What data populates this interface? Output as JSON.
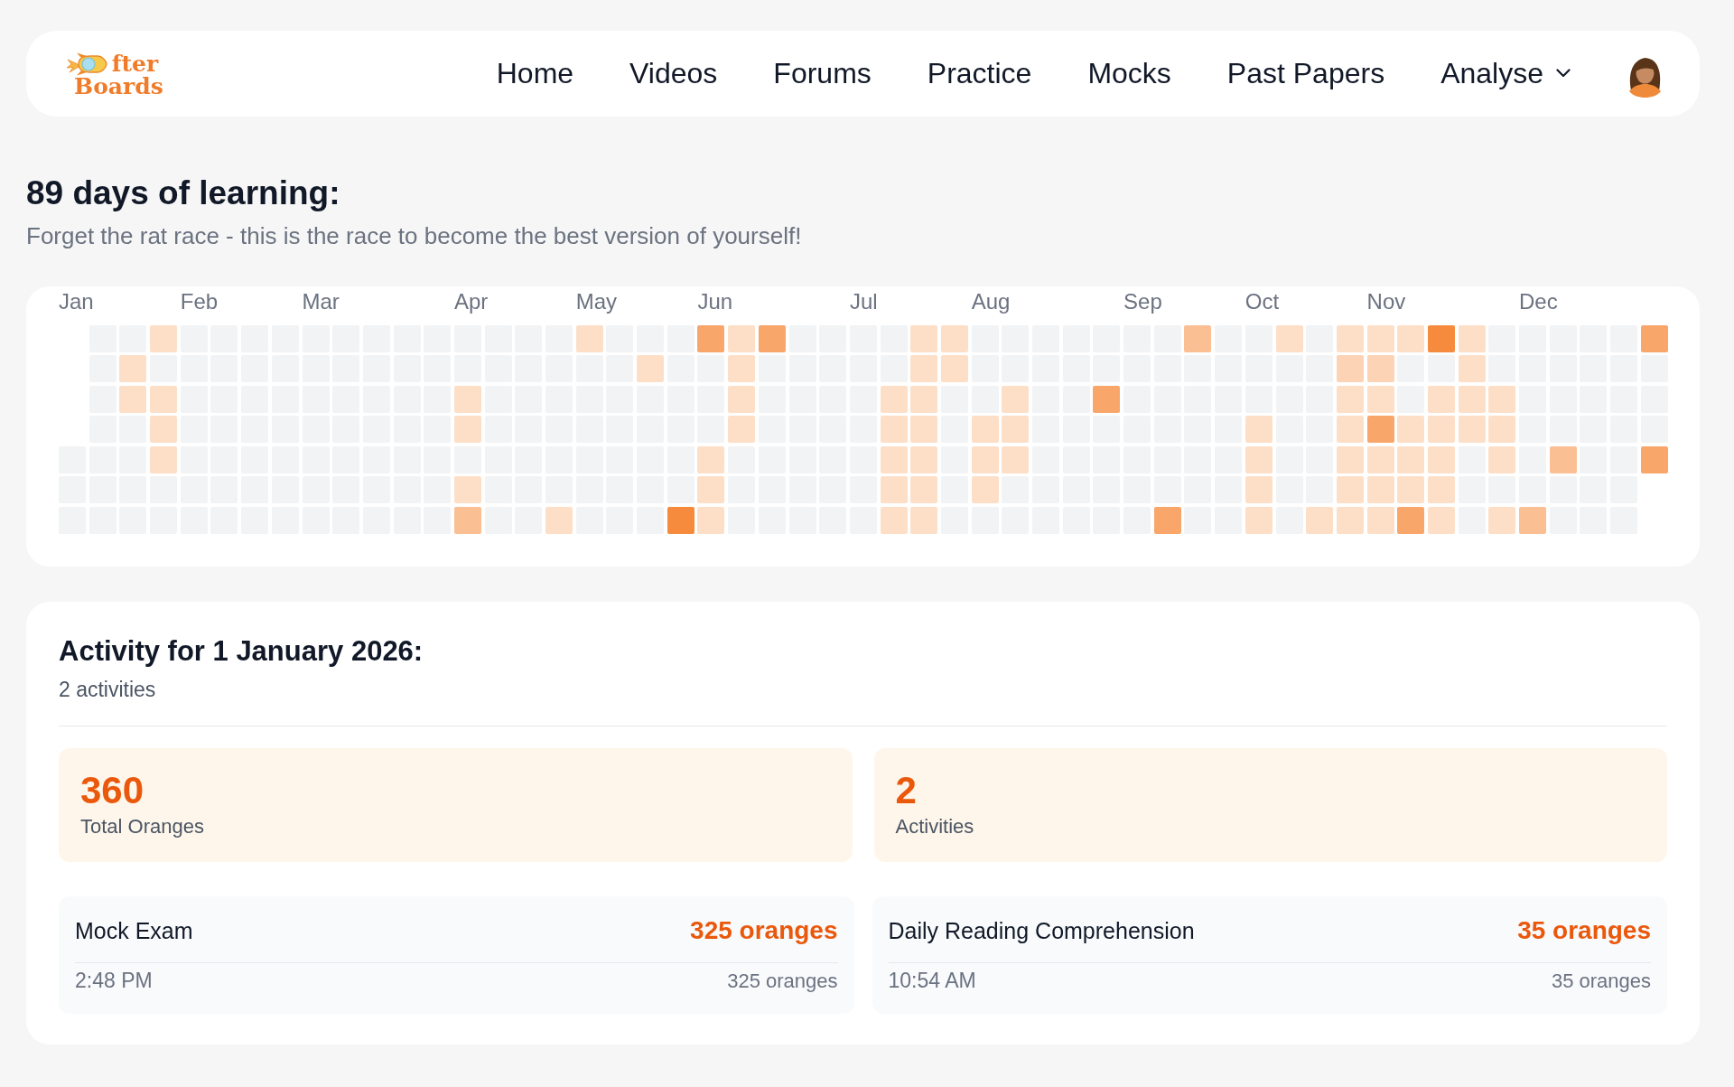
{
  "navbar": {
    "logo": {
      "lines": [
        "fter",
        "Boards"
      ]
    },
    "links": [
      {
        "label": "Home",
        "kind": "link"
      },
      {
        "label": "Videos",
        "kind": "link"
      },
      {
        "label": "Forums",
        "kind": "link"
      },
      {
        "label": "Practice",
        "kind": "link"
      },
      {
        "label": "Mocks",
        "kind": "link"
      },
      {
        "label": "Past Papers",
        "kind": "link"
      },
      {
        "label": "Analyse",
        "kind": "dropdown"
      }
    ]
  },
  "heading": {
    "title": "89 days of learning:",
    "subtitle": "Forget the rat race - this is the race to become the best version of yourself!"
  },
  "heatmap": {
    "weeks": [
      {
        "month": "Jan",
        "days": [
          {
            "color": "#f1f3f5"
          },
          {
            "color": "#f1f3f5"
          },
          {
            "color": "#f1f3f5"
          }
        ]
      },
      {
        "days": [
          {
            "color": "#f1f3f5"
          },
          {
            "color": "#f1f3f5"
          },
          {
            "color": "#f1f3f5"
          },
          {
            "color": "#f1f3f5"
          },
          {
            "color": "#f1f3f5"
          },
          {
            "color": "#f1f3f5"
          },
          {
            "color": "#f1f3f5"
          }
        ]
      },
      {
        "days": [
          {
            "color": "#f1f3f5"
          },
          {
            "color": "#fddfc8"
          },
          {
            "color": "#fddfc8"
          },
          {
            "color": "#f1f3f5"
          },
          {
            "color": "#f1f3f5"
          },
          {
            "color": "#f1f3f5"
          },
          {
            "color": "#f1f3f5"
          }
        ]
      },
      {
        "days": [
          {
            "color": "#fddfc8"
          },
          {
            "color": "#f1f3f5"
          },
          {
            "color": "#fddfc8"
          },
          {
            "color": "#fddfc8"
          },
          {
            "color": "#fddfc8"
          },
          {
            "color": "#f1f3f5"
          },
          {
            "color": "#f1f3f5"
          }
        ]
      },
      {
        "month": "Feb",
        "days": [
          {
            "color": "#f1f3f5"
          },
          {
            "color": "#f1f3f5"
          },
          {
            "color": "#f1f3f5"
          },
          {
            "color": "#f1f3f5"
          },
          {
            "color": "#f1f3f5"
          },
          {
            "color": "#f1f3f5"
          },
          {
            "color": "#f1f3f5"
          }
        ]
      },
      {
        "days": [
          {
            "color": "#f1f3f5"
          },
          {
            "color": "#f1f3f5"
          },
          {
            "color": "#f1f3f5"
          },
          {
            "color": "#f1f3f5"
          },
          {
            "color": "#f1f3f5"
          },
          {
            "color": "#f1f3f5"
          },
          {
            "color": "#f1f3f5"
          }
        ]
      },
      {
        "days": [
          {
            "color": "#f1f3f5"
          },
          {
            "color": "#f1f3f5"
          },
          {
            "color": "#f1f3f5"
          },
          {
            "color": "#f1f3f5"
          },
          {
            "color": "#f1f3f5"
          },
          {
            "color": "#f1f3f5"
          },
          {
            "color": "#f1f3f5"
          }
        ]
      },
      {
        "days": [
          {
            "color": "#f1f3f5"
          },
          {
            "color": "#f1f3f5"
          },
          {
            "color": "#f1f3f5"
          },
          {
            "color": "#f1f3f5"
          },
          {
            "color": "#f1f3f5"
          },
          {
            "color": "#f1f3f5"
          },
          {
            "color": "#f1f3f5"
          }
        ]
      },
      {
        "month": "Mar",
        "days": [
          {
            "color": "#f1f3f5"
          },
          {
            "color": "#f1f3f5"
          },
          {
            "color": "#f1f3f5"
          },
          {
            "color": "#f1f3f5"
          },
          {
            "color": "#f1f3f5"
          },
          {
            "color": "#f1f3f5"
          },
          {
            "color": "#f1f3f5"
          }
        ]
      },
      {
        "days": [
          {
            "color": "#f1f3f5"
          },
          {
            "color": "#f1f3f5"
          },
          {
            "color": "#f1f3f5"
          },
          {
            "color": "#f1f3f5"
          },
          {
            "color": "#f1f3f5"
          },
          {
            "color": "#f1f3f5"
          },
          {
            "color": "#f1f3f5"
          }
        ]
      },
      {
        "days": [
          {
            "color": "#f1f3f5"
          },
          {
            "color": "#f1f3f5"
          },
          {
            "color": "#f1f3f5"
          },
          {
            "color": "#f1f3f5"
          },
          {
            "color": "#f1f3f5"
          },
          {
            "color": "#f1f3f5"
          },
          {
            "color": "#f1f3f5"
          }
        ]
      },
      {
        "days": [
          {
            "color": "#f1f3f5"
          },
          {
            "color": "#f1f3f5"
          },
          {
            "color": "#f1f3f5"
          },
          {
            "color": "#f1f3f5"
          },
          {
            "color": "#f1f3f5"
          },
          {
            "color": "#f1f3f5"
          },
          {
            "color": "#f1f3f5"
          }
        ]
      },
      {
        "days": [
          {
            "color": "#f1f3f5"
          },
          {
            "color": "#f1f3f5"
          },
          {
            "color": "#f1f3f5"
          },
          {
            "color": "#f1f3f5"
          },
          {
            "color": "#f1f3f5"
          },
          {
            "color": "#f1f3f5"
          },
          {
            "color": "#f1f3f5"
          }
        ]
      },
      {
        "month": "Apr",
        "days": [
          {
            "color": "#f1f3f5"
          },
          {
            "color": "#f1f3f5"
          },
          {
            "color": "#fddfc8"
          },
          {
            "color": "#fddfc8"
          },
          {
            "color": "#f1f3f5"
          },
          {
            "color": "#fddfc8"
          },
          {
            "color": "#fbbf94"
          }
        ]
      },
      {
        "days": [
          {
            "color": "#f1f3f5"
          },
          {
            "color": "#f1f3f5"
          },
          {
            "color": "#f1f3f5"
          },
          {
            "color": "#f1f3f5"
          },
          {
            "color": "#f1f3f5"
          },
          {
            "color": "#f1f3f5"
          },
          {
            "color": "#f1f3f5"
          }
        ]
      },
      {
        "days": [
          {
            "color": "#f1f3f5"
          },
          {
            "color": "#f1f3f5"
          },
          {
            "color": "#f1f3f5"
          },
          {
            "color": "#f1f3f5"
          },
          {
            "color": "#f1f3f5"
          },
          {
            "color": "#f1f3f5"
          },
          {
            "color": "#f1f3f5"
          }
        ]
      },
      {
        "days": [
          {
            "color": "#f1f3f5"
          },
          {
            "color": "#f1f3f5"
          },
          {
            "color": "#f1f3f5"
          },
          {
            "color": "#f1f3f5"
          },
          {
            "color": "#f1f3f5"
          },
          {
            "color": "#f1f3f5"
          },
          {
            "color": "#fddfc8"
          }
        ]
      },
      {
        "month": "May",
        "days": [
          {
            "color": "#fddfc8"
          },
          {
            "color": "#f1f3f5"
          },
          {
            "color": "#f1f3f5"
          },
          {
            "color": "#f1f3f5"
          },
          {
            "color": "#f1f3f5"
          },
          {
            "color": "#f1f3f5"
          },
          {
            "color": "#f1f3f5"
          }
        ]
      },
      {
        "days": [
          {
            "color": "#f1f3f5"
          },
          {
            "color": "#f1f3f5"
          },
          {
            "color": "#f1f3f5"
          },
          {
            "color": "#f1f3f5"
          },
          {
            "color": "#f1f3f5"
          },
          {
            "color": "#f1f3f5"
          },
          {
            "color": "#f1f3f5"
          }
        ]
      },
      {
        "days": [
          {
            "color": "#f1f3f5"
          },
          {
            "color": "#fddfc8"
          },
          {
            "color": "#f1f3f5"
          },
          {
            "color": "#f1f3f5"
          },
          {
            "color": "#f1f3f5"
          },
          {
            "color": "#f1f3f5"
          },
          {
            "color": "#f1f3f5"
          }
        ]
      },
      {
        "days": [
          {
            "color": "#f1f3f5"
          },
          {
            "color": "#f1f3f5"
          },
          {
            "color": "#f1f3f5"
          },
          {
            "color": "#f1f3f5"
          },
          {
            "color": "#f1f3f5"
          },
          {
            "color": "#f1f3f5"
          },
          {
            "color": "#f78b3d"
          }
        ]
      },
      {
        "month": "Jun",
        "days": [
          {
            "color": "#f9a66b"
          },
          {
            "color": "#f1f3f5"
          },
          {
            "color": "#f1f3f5"
          },
          {
            "color": "#f1f3f5"
          },
          {
            "color": "#fddfc8"
          },
          {
            "color": "#fddfc8"
          },
          {
            "color": "#fddfc8"
          }
        ]
      },
      {
        "days": [
          {
            "color": "#fddfc8"
          },
          {
            "color": "#fddfc8"
          },
          {
            "color": "#fddfc8"
          },
          {
            "color": "#fddfc8"
          },
          {
            "color": "#f1f3f5"
          },
          {
            "color": "#f1f3f5"
          },
          {
            "color": "#f1f3f5"
          }
        ]
      },
      {
        "days": [
          {
            "color": "#f9a66b"
          },
          {
            "color": "#f1f3f5"
          },
          {
            "color": "#f1f3f5"
          },
          {
            "color": "#f1f3f5"
          },
          {
            "color": "#f1f3f5"
          },
          {
            "color": "#f1f3f5"
          },
          {
            "color": "#f1f3f5"
          }
        ]
      },
      {
        "days": [
          {
            "color": "#f1f3f5"
          },
          {
            "color": "#f1f3f5"
          },
          {
            "color": "#f1f3f5"
          },
          {
            "color": "#f1f3f5"
          },
          {
            "color": "#f1f3f5"
          },
          {
            "color": "#f1f3f5"
          },
          {
            "color": "#f1f3f5"
          }
        ]
      },
      {
        "days": [
          {
            "color": "#f1f3f5"
          },
          {
            "color": "#f1f3f5"
          },
          {
            "color": "#f1f3f5"
          },
          {
            "color": "#f1f3f5"
          },
          {
            "color": "#f1f3f5"
          },
          {
            "color": "#f1f3f5"
          },
          {
            "color": "#f1f3f5"
          }
        ]
      },
      {
        "month": "Jul",
        "days": [
          {
            "color": "#f1f3f5"
          },
          {
            "color": "#f1f3f5"
          },
          {
            "color": "#f1f3f5"
          },
          {
            "color": "#f1f3f5"
          },
          {
            "color": "#f1f3f5"
          },
          {
            "color": "#f1f3f5"
          },
          {
            "color": "#f1f3f5"
          }
        ]
      },
      {
        "days": [
          {
            "color": "#f1f3f5"
          },
          {
            "color": "#f1f3f5"
          },
          {
            "color": "#fddfc8"
          },
          {
            "color": "#fddfc8"
          },
          {
            "color": "#fddfc8"
          },
          {
            "color": "#fddfc8"
          },
          {
            "color": "#fddfc8"
          }
        ]
      },
      {
        "days": [
          {
            "color": "#fddfc8"
          },
          {
            "color": "#fddfc8"
          },
          {
            "color": "#fddfc8"
          },
          {
            "color": "#fddfc8"
          },
          {
            "color": "#fddfc8"
          },
          {
            "color": "#fddfc8"
          },
          {
            "color": "#fddfc8"
          }
        ]
      },
      {
        "days": [
          {
            "color": "#fddfc8"
          },
          {
            "color": "#fddfc8"
          },
          {
            "color": "#f1f3f5"
          },
          {
            "color": "#f1f3f5"
          },
          {
            "color": "#f1f3f5"
          },
          {
            "color": "#f1f3f5"
          },
          {
            "color": "#f1f3f5"
          }
        ]
      },
      {
        "month": "Aug",
        "days": [
          {
            "color": "#f1f3f5"
          },
          {
            "color": "#f1f3f5"
          },
          {
            "color": "#f1f3f5"
          },
          {
            "color": "#fddfc8"
          },
          {
            "color": "#fddfc8"
          },
          {
            "color": "#fddfc8"
          },
          {
            "color": "#f1f3f5"
          }
        ]
      },
      {
        "days": [
          {
            "color": "#f1f3f5"
          },
          {
            "color": "#f1f3f5"
          },
          {
            "color": "#fddfc8"
          },
          {
            "color": "#fddfc8"
          },
          {
            "color": "#fddfc8"
          },
          {
            "color": "#f1f3f5"
          },
          {
            "color": "#f1f3f5"
          }
        ]
      },
      {
        "days": [
          {
            "color": "#f1f3f5"
          },
          {
            "color": "#f1f3f5"
          },
          {
            "color": "#f1f3f5"
          },
          {
            "color": "#f1f3f5"
          },
          {
            "color": "#f1f3f5"
          },
          {
            "color": "#f1f3f5"
          },
          {
            "color": "#f1f3f5"
          }
        ]
      },
      {
        "days": [
          {
            "color": "#f1f3f5"
          },
          {
            "color": "#f1f3f5"
          },
          {
            "color": "#f1f3f5"
          },
          {
            "color": "#f1f3f5"
          },
          {
            "color": "#f1f3f5"
          },
          {
            "color": "#f1f3f5"
          },
          {
            "color": "#f1f3f5"
          }
        ]
      },
      {
        "days": [
          {
            "color": "#f1f3f5"
          },
          {
            "color": "#f1f3f5"
          },
          {
            "color": "#f9a66b"
          },
          {
            "color": "#f1f3f5"
          },
          {
            "color": "#f1f3f5"
          },
          {
            "color": "#f1f3f5"
          },
          {
            "color": "#f1f3f5"
          }
        ]
      },
      {
        "month": "Sep",
        "days": [
          {
            "color": "#f1f3f5"
          },
          {
            "color": "#f1f3f5"
          },
          {
            "color": "#f1f3f5"
          },
          {
            "color": "#f1f3f5"
          },
          {
            "color": "#f1f3f5"
          },
          {
            "color": "#f1f3f5"
          },
          {
            "color": "#f1f3f5"
          }
        ]
      },
      {
        "days": [
          {
            "color": "#f1f3f5"
          },
          {
            "color": "#f1f3f5"
          },
          {
            "color": "#f1f3f5"
          },
          {
            "color": "#f1f3f5"
          },
          {
            "color": "#f1f3f5"
          },
          {
            "color": "#f1f3f5"
          },
          {
            "color": "#f9a66b"
          }
        ]
      },
      {
        "days": [
          {
            "color": "#fbbf94"
          },
          {
            "color": "#f1f3f5"
          },
          {
            "color": "#f1f3f5"
          },
          {
            "color": "#f1f3f5"
          },
          {
            "color": "#f1f3f5"
          },
          {
            "color": "#f1f3f5"
          },
          {
            "color": "#f1f3f5"
          }
        ]
      },
      {
        "days": [
          {
            "color": "#f1f3f5"
          },
          {
            "color": "#f1f3f5"
          },
          {
            "color": "#f1f3f5"
          },
          {
            "color": "#f1f3f5"
          },
          {
            "color": "#f1f3f5"
          },
          {
            "color": "#f1f3f5"
          },
          {
            "color": "#f1f3f5"
          }
        ]
      },
      {
        "month": "Oct",
        "days": [
          {
            "color": "#f1f3f5"
          },
          {
            "color": "#f1f3f5"
          },
          {
            "color": "#f1f3f5"
          },
          {
            "color": "#fddfc8"
          },
          {
            "color": "#fddfc8"
          },
          {
            "color": "#fddfc8"
          },
          {
            "color": "#fddfc8"
          }
        ]
      },
      {
        "days": [
          {
            "color": "#fddfc8"
          },
          {
            "color": "#f1f3f5"
          },
          {
            "color": "#f1f3f5"
          },
          {
            "color": "#f1f3f5"
          },
          {
            "color": "#f1f3f5"
          },
          {
            "color": "#f1f3f5"
          },
          {
            "color": "#f1f3f5"
          }
        ]
      },
      {
        "days": [
          {
            "color": "#f1f3f5"
          },
          {
            "color": "#f1f3f5"
          },
          {
            "color": "#f1f3f5"
          },
          {
            "color": "#f1f3f5"
          },
          {
            "color": "#f1f3f5"
          },
          {
            "color": "#f1f3f5"
          },
          {
            "color": "#fddfc8"
          }
        ]
      },
      {
        "days": [
          {
            "color": "#fddfc8"
          },
          {
            "color": "#fcd3b5"
          },
          {
            "color": "#fddfc8"
          },
          {
            "color": "#fddfc8"
          },
          {
            "color": "#fddfc8"
          },
          {
            "color": "#fddfc8"
          },
          {
            "color": "#fddfc8"
          }
        ]
      },
      {
        "month": "Nov",
        "days": [
          {
            "color": "#fddfc8"
          },
          {
            "color": "#fcd3b5"
          },
          {
            "color": "#fddfc8"
          },
          {
            "color": "#f9a66b"
          },
          {
            "color": "#fddfc8"
          },
          {
            "color": "#fddfc8"
          },
          {
            "color": "#fddfc8"
          }
        ]
      },
      {
        "days": [
          {
            "color": "#fddfc8"
          },
          {
            "color": "#f1f3f5"
          },
          {
            "color": "#f1f3f5"
          },
          {
            "color": "#fddfc8"
          },
          {
            "color": "#fddfc8"
          },
          {
            "color": "#fddfc8"
          },
          {
            "color": "#f9a66b"
          }
        ]
      },
      {
        "days": [
          {
            "color": "#f78b3d"
          },
          {
            "color": "#f1f3f5"
          },
          {
            "color": "#fddfc8"
          },
          {
            "color": "#fddfc8"
          },
          {
            "color": "#fddfc8"
          },
          {
            "color": "#fddfc8"
          },
          {
            "color": "#fddfc8"
          }
        ]
      },
      {
        "days": [
          {
            "color": "#fddfc8"
          },
          {
            "color": "#fddfc8"
          },
          {
            "color": "#fddfc8"
          },
          {
            "color": "#fddfc8"
          },
          {
            "color": "#f1f3f5"
          },
          {
            "color": "#f1f3f5"
          },
          {
            "color": "#f1f3f5"
          }
        ]
      },
      {
        "days": [
          {
            "color": "#f1f3f5"
          },
          {
            "color": "#f1f3f5"
          },
          {
            "color": "#fddfc8"
          },
          {
            "color": "#fddfc8"
          },
          {
            "color": "#fddfc8"
          },
          {
            "color": "#f1f3f5"
          },
          {
            "color": "#fddfc8"
          }
        ]
      },
      {
        "month": "Dec",
        "days": [
          {
            "color": "#f1f3f5"
          },
          {
            "color": "#f1f3f5"
          },
          {
            "color": "#f1f3f5"
          },
          {
            "color": "#f1f3f5"
          },
          {
            "color": "#f1f3f5"
          },
          {
            "color": "#f1f3f5"
          },
          {
            "color": "#fbbf94"
          }
        ]
      },
      {
        "days": [
          {
            "color": "#f1f3f5"
          },
          {
            "color": "#f1f3f5"
          },
          {
            "color": "#f1f3f5"
          },
          {
            "color": "#f1f3f5"
          },
          {
            "color": "#fbbf94"
          },
          {
            "color": "#f1f3f5"
          },
          {
            "color": "#f1f3f5"
          }
        ]
      },
      {
        "days": [
          {
            "color": "#f1f3f5"
          },
          {
            "color": "#f1f3f5"
          },
          {
            "color": "#f1f3f5"
          },
          {
            "color": "#f1f3f5"
          },
          {
            "color": "#f1f3f5"
          },
          {
            "color": "#f1f3f5"
          },
          {
            "color": "#f1f3f5"
          }
        ]
      },
      {
        "days": [
          {
            "color": "#f1f3f5"
          },
          {
            "color": "#f1f3f5"
          },
          {
            "color": "#f1f3f5"
          },
          {
            "color": "#f1f3f5"
          },
          {
            "color": "#f1f3f5"
          },
          {
            "color": "#f1f3f5"
          },
          {
            "color": "#f1f3f5"
          }
        ]
      },
      {
        "days": [
          {
            "color": "#f9a66b"
          },
          {
            "color": "#f1f3f5"
          },
          {
            "color": "#f1f3f5"
          },
          {
            "color": "#f1f3f5"
          },
          {
            "color": "#f9a66b"
          }
        ]
      }
    ]
  },
  "activity": {
    "title": "Activity for 1 January 2026:",
    "subtitle": "2 activities",
    "stats": [
      {
        "value": "360",
        "label": "Total Oranges"
      },
      {
        "value": "2",
        "label": "Activities"
      }
    ],
    "entries": [
      {
        "name": "Mock Exam",
        "oranges": "325 oranges",
        "time": "2:48 PM",
        "detail": "325 oranges"
      },
      {
        "name": "Daily Reading Comprehension",
        "oranges": "35 oranges",
        "time": "10:54 AM",
        "detail": "35 oranges"
      }
    ]
  }
}
